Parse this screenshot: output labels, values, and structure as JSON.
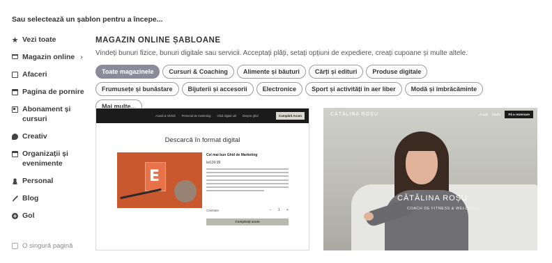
{
  "prompt": "Sau selectează un șablon pentru a începe...",
  "sidebar": {
    "items": [
      {
        "label": "Vezi toate",
        "icon": "star-icon"
      },
      {
        "label": "Magazin online",
        "icon": "cart-icon",
        "chevron": "›"
      },
      {
        "label": "Afaceri",
        "icon": "document-icon"
      },
      {
        "label": "Pagina de pornire",
        "icon": "window-icon"
      },
      {
        "label": "Abonament și cursuri",
        "icon": "id-card-icon"
      },
      {
        "label": "Creativ",
        "icon": "palette-icon"
      },
      {
        "label": "Organizații și evenimente",
        "icon": "calendar-icon"
      },
      {
        "label": "Personal",
        "icon": "user-icon"
      },
      {
        "label": "Blog",
        "icon": "feather-icon"
      },
      {
        "label": "Gol",
        "icon": "plus-circle-icon"
      }
    ],
    "single_page_label": "O singură pagină",
    "single_page_checked": false
  },
  "section": {
    "title": "MAGAZIN ONLINE ȘABLOANE",
    "description": "Vindeți bunuri fizice, bunuri digitale sau servicii. Acceptați plăți, setați opțiuni de expediere, creați cupoane și multe altele."
  },
  "filters": [
    {
      "label": "Toate magazinele",
      "active": true
    },
    {
      "label": "Cursuri & Coaching",
      "active": false
    },
    {
      "label": "Alimente și băuturi",
      "active": false
    },
    {
      "label": "Cărți și edituri",
      "active": false
    },
    {
      "label": "Produse digitale",
      "active": false
    },
    {
      "label": "Frumusețe și bunăstare",
      "active": false
    },
    {
      "label": "Bijuterii și accesorii",
      "active": false
    },
    {
      "label": "Electronice",
      "active": false
    },
    {
      "label": "Sport și activități în aer liber",
      "active": false
    },
    {
      "label": "Modă și îmbrăcăminte",
      "active": false
    },
    {
      "label": "Mai multe...",
      "active": false
    }
  ],
  "templates": [
    {
      "nav_links": [
        "Acasă & Vitrină",
        "Personal de marketing",
        "Ghid digital util",
        "Despre ghid"
      ],
      "nav_button": "Cumpără Acum",
      "heading": "Descarcă în format digital",
      "product_title": "Cel mai bun Ghid de Marketing",
      "price": "lei139.99",
      "quantity_label": "Cantitate",
      "quantity": "1",
      "minus": "−",
      "plus": "+",
      "buy_button": "Cumpărați acum",
      "image_letter": "E"
    },
    {
      "logo": "CĂTĂLINA ROȘU",
      "nav_links": [
        "Acasă",
        "Studio"
      ],
      "nav_button": "Fă o rezervare",
      "name": "CĂTĂLINA ROȘU",
      "subtitle": "COACH DE FITNESS & WELLNESS"
    }
  ],
  "colors": {
    "active_chip": "#8a8a9a",
    "card1_image": "#c9582f",
    "dark_nav": "#1b1b1b"
  }
}
